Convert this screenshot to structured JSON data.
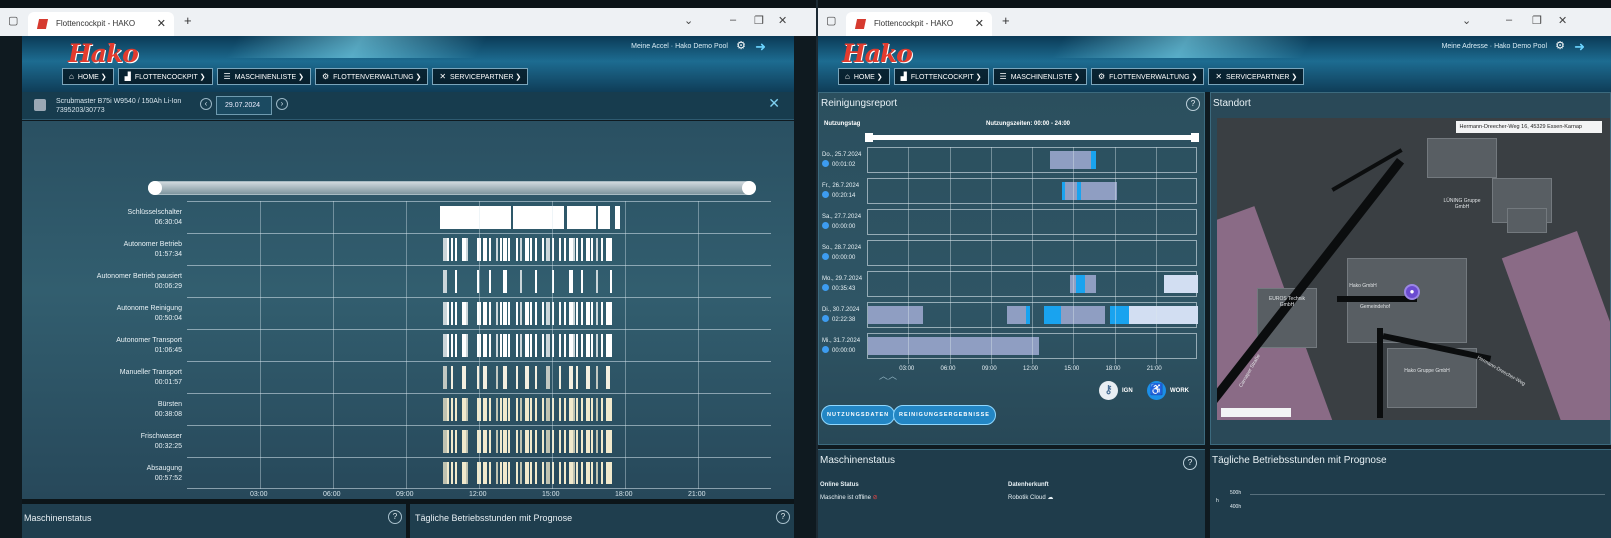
{
  "browser": {
    "tab_title": "Flottencockpit - HAKO",
    "new_tab": "+",
    "controls": {
      "chevron": "⌄",
      "minimize": "–",
      "restore": "❐",
      "close": "✕"
    }
  },
  "header": {
    "logo": "Hako",
    "user_left": "Meine Accel · Hako Demo Pool",
    "user_right": "Meine Adresse · Hako Demo Pool"
  },
  "nav": [
    {
      "label": "HOME",
      "icon": "home-icon"
    },
    {
      "label": "FLOTTENCOCKPIT",
      "icon": "cockpit-icon"
    },
    {
      "label": "MASCHINENLISTE",
      "icon": "list-icon"
    },
    {
      "label": "FLOTTENVERWALTUNG",
      "icon": "fleet-icon"
    },
    {
      "label": "SERVICEPARTNER",
      "icon": "tools-icon"
    }
  ],
  "machine": {
    "name": "Scrubmaster B75i W9540 / 150Ah Li-Ion",
    "serial": "7395203/30773",
    "date": "29.07.2024"
  },
  "timeline_left": {
    "x_ticks": [
      "03:00",
      "06:00",
      "09:00",
      "12:00",
      "15:00",
      "18:00",
      "21:00"
    ],
    "rows": [
      {
        "label": "Schlüsselschalter",
        "value": "06:30:04",
        "color": "#ffffff"
      },
      {
        "label": "Autonomer Betrieb",
        "value": "01:57:34",
        "color": "#ffffff"
      },
      {
        "label": "Autonomer Betrieb pausiert",
        "value": "00:06:29",
        "color": "#ffffff"
      },
      {
        "label": "Autonome Reinigung",
        "value": "00:50:04",
        "color": "#ffffff"
      },
      {
        "label": "Autonomer Transport",
        "value": "01:06:45",
        "color": "#ffffff"
      },
      {
        "label": "Manueller Transport",
        "value": "00:01:57",
        "color": "#f4efe0"
      },
      {
        "label": "Bürsten",
        "value": "00:38:08",
        "color": "#f1e9cc"
      },
      {
        "label": "Frischwasser",
        "value": "00:32:25",
        "color": "#f1e9cc"
      },
      {
        "label": "Absaugung",
        "value": "00:57:52",
        "color": "#f1e9cc"
      }
    ]
  },
  "bottom_left": {
    "status_title": "Maschinenstatus",
    "hours_title": "Tägliche Betriebsstunden mit Prognose"
  },
  "report": {
    "title": "Reinigungsreport",
    "col_day": "Nutzungstag",
    "col_times": "Nutzungszeiten: 00:00 - 24:00",
    "x_ticks": [
      "03:00",
      "06:00",
      "09:00",
      "12:00",
      "15:00",
      "18:00",
      "21:00"
    ],
    "days": [
      {
        "day": "Do., 25.7.2024",
        "time": "00:01:02"
      },
      {
        "day": "Fr., 26.7.2024",
        "time": "00:20:14"
      },
      {
        "day": "Sa., 27.7.2024",
        "time": "00:00:00"
      },
      {
        "day": "So., 28.7.2024",
        "time": "00:00:00"
      },
      {
        "day": "Mo., 29.7.2024",
        "time": "00:35:43"
      },
      {
        "day": "Di., 30.7.2024",
        "time": "02:22:38"
      },
      {
        "day": "Mi., 31.7.2024",
        "time": "00:00:00"
      }
    ],
    "legend": [
      {
        "label": "IGN",
        "icon": "key-icon",
        "color": "#8fb2d8"
      },
      {
        "label": "WORK",
        "icon": "operator-icon",
        "color": "#1b8fe8"
      }
    ],
    "buttons": [
      "NUTZUNGSDATEN",
      "REINIGUNGSERGEBNISSE"
    ]
  },
  "location": {
    "title": "Standort",
    "address": "Hermann-Dreecher-Weg 16, 45329 Essen-Karnap",
    "street_1": "Gemeindehof",
    "street_2": "Hermann-Dreecher-Weg",
    "street_3": "Carnaper Straße",
    "poi_1": "Hako Gruppe GmbH",
    "poi_2": "Hako GmbH",
    "poi_3": "LÜNING Gruppe GmbH",
    "poi_4": "EUROS Technik GmbH"
  },
  "status": {
    "title": "Maschinenstatus",
    "online_label": "Online Status",
    "online_value": "Maschine ist offline",
    "source_label": "Datenherkunft",
    "source_value": "Robotik Cloud",
    "hours_title": "Tägliche Betriebsstunden mit Prognose",
    "y_ticks": [
      "500h",
      "400h"
    ],
    "y_unit": "h"
  }
}
